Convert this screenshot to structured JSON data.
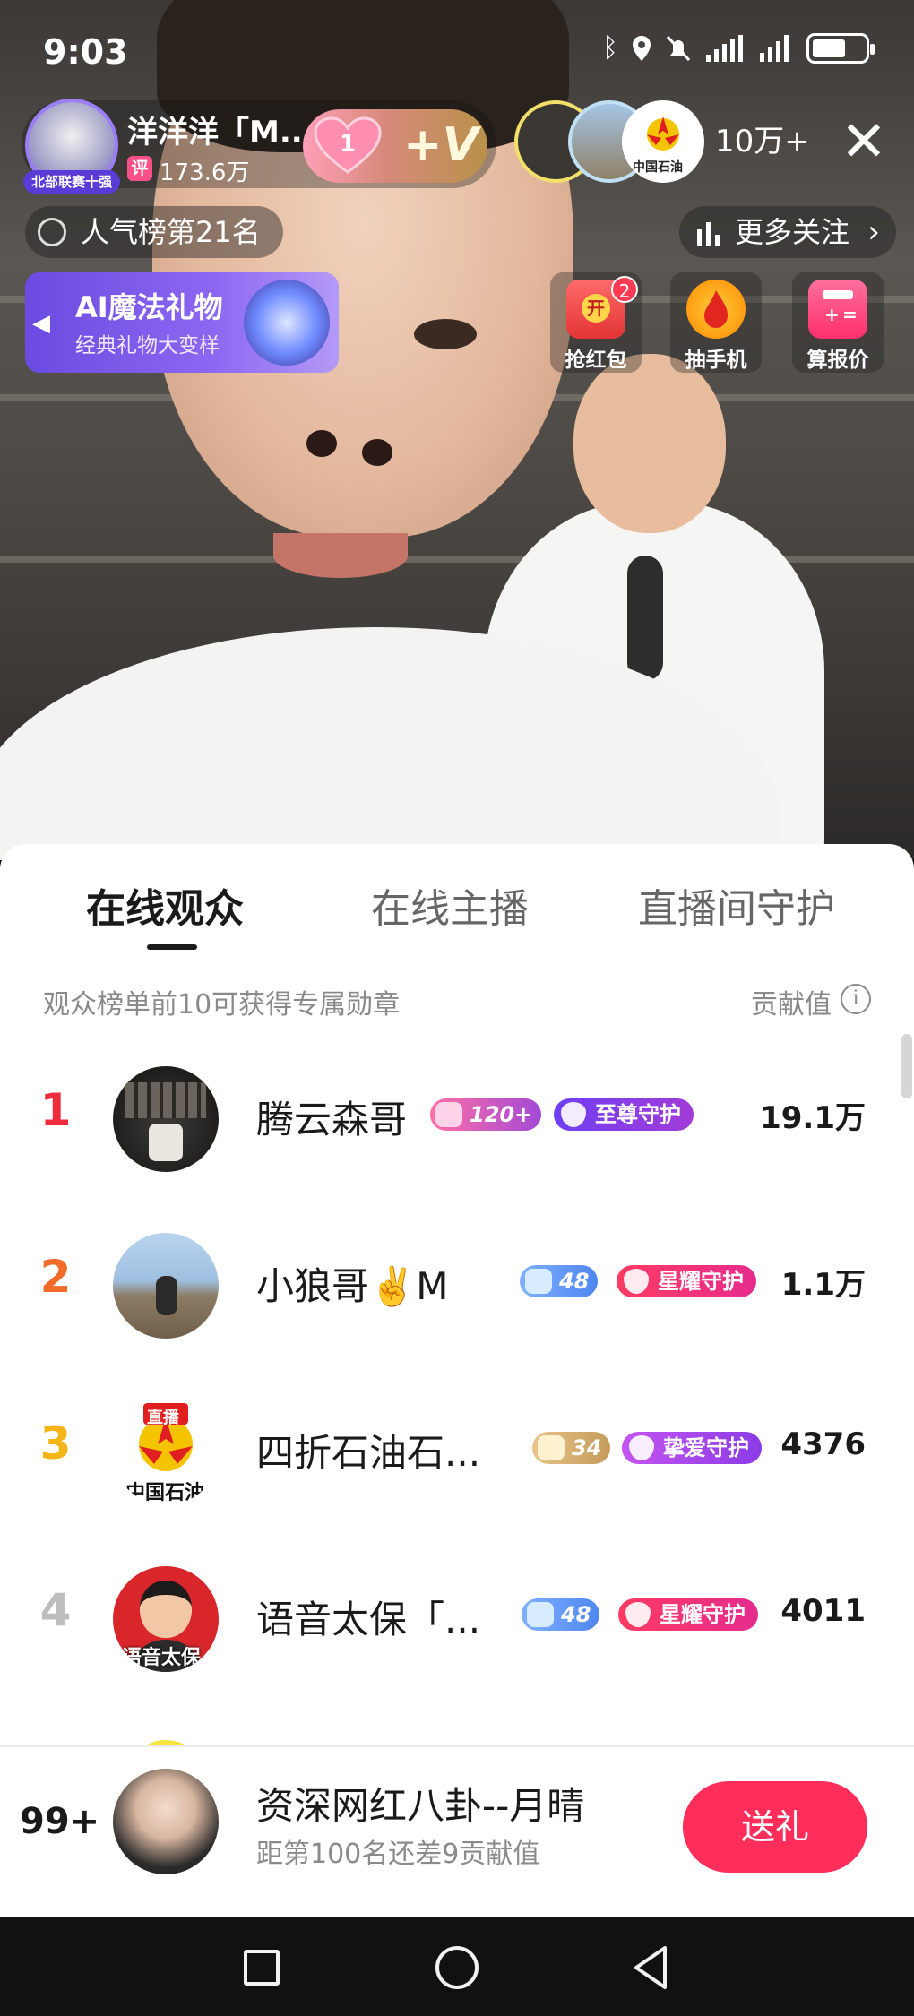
{
  "status_bar": {
    "time": "9:03",
    "icons": [
      "bluetooth-icon",
      "location-icon",
      "mute-icon",
      "signal-icon",
      "signal-icon",
      "battery-icon"
    ]
  },
  "host": {
    "name": "洋洋洋「M...",
    "avatar_tag": "北部联赛十强",
    "badge": "评",
    "fans": "173.6万",
    "heart_count": "1",
    "follow_label": "+V"
  },
  "viewers": {
    "count": "10万+",
    "avatar3_label": "中国石油"
  },
  "rank_chip": "人气榜第21名",
  "more_follow": "更多关注",
  "ai_banner": {
    "title": "AI魔法礼物",
    "subtitle": "经典礼物大变样"
  },
  "tools": [
    {
      "label": "抢红包",
      "icon": "red-packet-icon",
      "badge": "2",
      "glyph": "开"
    },
    {
      "label": "抽手机",
      "icon": "phone-lottery-icon"
    },
    {
      "label": "算报价",
      "icon": "calculator-icon"
    }
  ],
  "sheet": {
    "tabs": [
      "在线观众",
      "在线主播",
      "直播间守护"
    ],
    "hint": "观众榜单前10可获得专属勋章",
    "contrib_label": "贡献值",
    "rows": [
      {
        "rank": "1",
        "name": "腾云森哥",
        "level": "120+",
        "guard": "至尊守护",
        "score": "19.1万"
      },
      {
        "rank": "2",
        "name": "小狼哥✌️M",
        "level": "48",
        "guard": "星耀守护",
        "score": "1.1万"
      },
      {
        "rank": "3",
        "name": "四折石油石...",
        "avatar_text": "中国石油",
        "avatar_badge": "直播",
        "level": "34",
        "guard": "挚爱守护",
        "score": "4376"
      },
      {
        "rank": "4",
        "name": "语音太保「...",
        "avatar_text": "语音太保",
        "level": "48",
        "guard": "星耀守护",
        "score": "4011"
      }
    ],
    "me": {
      "rank": "99+",
      "name": "资深网红八卦--月晴",
      "sub": "距第100名还差9贡献值",
      "button": "送礼"
    }
  },
  "colors": {
    "rank1": "#ee2b3b",
    "rank2": "#f26b28",
    "rank3": "#f5b417",
    "rank4": "#bdbdbd",
    "accent": "#ff2d5a"
  }
}
